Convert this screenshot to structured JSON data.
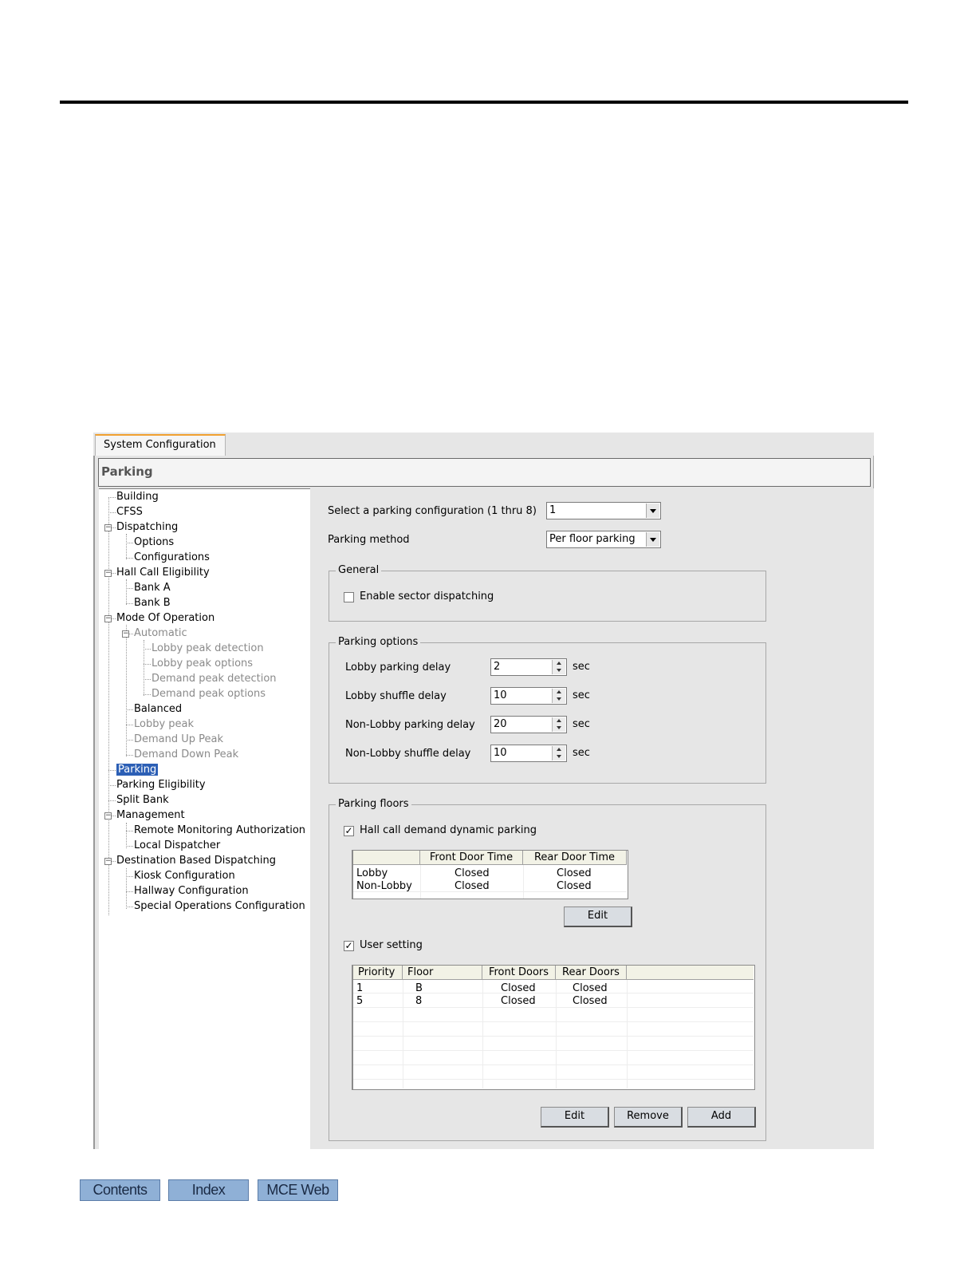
{
  "window": {
    "tab_label": "System Configuration",
    "section_title": "Parking"
  },
  "tree": {
    "items": [
      {
        "label": "Building",
        "level": 0,
        "state": "normal"
      },
      {
        "label": "CFSS",
        "level": 0,
        "state": "normal"
      },
      {
        "label": "Dispatching",
        "level": 0,
        "state": "expanded"
      },
      {
        "label": "Options",
        "level": 1,
        "state": "normal"
      },
      {
        "label": "Configurations",
        "level": 1,
        "state": "normal"
      },
      {
        "label": "Hall Call Eligibility",
        "level": 0,
        "state": "expanded"
      },
      {
        "label": "Bank A",
        "level": 1,
        "state": "normal"
      },
      {
        "label": "Bank B",
        "level": 1,
        "state": "normal"
      },
      {
        "label": "Mode Of Operation",
        "level": 0,
        "state": "expanded"
      },
      {
        "label": "Automatic",
        "level": 1,
        "state": "expanded-disabled"
      },
      {
        "label": "Lobby peak detection",
        "level": 2,
        "state": "disabled"
      },
      {
        "label": "Lobby peak options",
        "level": 2,
        "state": "disabled"
      },
      {
        "label": "Demand peak detection",
        "level": 2,
        "state": "disabled"
      },
      {
        "label": "Demand peak options",
        "level": 2,
        "state": "disabled"
      },
      {
        "label": "Balanced",
        "level": 1,
        "state": "normal"
      },
      {
        "label": "Lobby peak",
        "level": 1,
        "state": "disabled"
      },
      {
        "label": "Demand Up Peak",
        "level": 1,
        "state": "disabled"
      },
      {
        "label": "Demand Down Peak",
        "level": 1,
        "state": "disabled"
      },
      {
        "label": "Parking",
        "level": 0,
        "state": "selected"
      },
      {
        "label": "Parking Eligibility",
        "level": 0,
        "state": "normal"
      },
      {
        "label": "Split Bank",
        "level": 0,
        "state": "normal"
      },
      {
        "label": "Management",
        "level": 0,
        "state": "expanded"
      },
      {
        "label": "Remote Monitoring Authorization",
        "level": 1,
        "state": "normal"
      },
      {
        "label": "Local Dispatcher",
        "level": 1,
        "state": "normal"
      },
      {
        "label": "Destination Based Dispatching",
        "level": 0,
        "state": "expanded"
      },
      {
        "label": "Kiosk Configuration",
        "level": 1,
        "state": "normal"
      },
      {
        "label": "Hallway Configuration",
        "level": 1,
        "state": "normal"
      },
      {
        "label": "Special Operations Configuration",
        "level": 1,
        "state": "normal"
      }
    ]
  },
  "form": {
    "config_label": "Select a parking configuration (1 thru 8)",
    "config_value": "1",
    "method_label": "Parking method",
    "method_value": "Per floor parking",
    "general": {
      "legend": "General",
      "enable_sector_label": "Enable sector dispatching",
      "enable_sector_checked": false
    },
    "options": {
      "legend": "Parking options",
      "unit": "sec",
      "rows": [
        {
          "label": "Lobby parking delay",
          "value": "2"
        },
        {
          "label": "Lobby shuffle delay",
          "value": "10"
        },
        {
          "label": "Non-Lobby parking delay",
          "value": "20"
        },
        {
          "label": "Non-Lobby shuffle delay",
          "value": "10"
        }
      ]
    },
    "floors": {
      "legend": "Parking floors",
      "hall_call_label": "Hall call demand dynamic parking",
      "hall_call_checked": true,
      "door_table": {
        "headers": [
          "",
          "Front Door Time",
          "Rear Door Time"
        ],
        "rows": [
          [
            "Lobby",
            "Closed",
            "Closed"
          ],
          [
            "Non-Lobby",
            "Closed",
            "Closed"
          ]
        ]
      },
      "edit_label": "Edit",
      "user_setting_label": "User setting",
      "user_setting_checked": true,
      "user_table": {
        "headers": [
          "Priority",
          "Floor",
          "Front Doors",
          "Rear Doors"
        ],
        "rows": [
          [
            "1",
            "B",
            "Closed",
            "Closed"
          ],
          [
            "5",
            "8",
            "Closed",
            "Closed"
          ]
        ]
      },
      "buttons": {
        "edit": "Edit",
        "remove": "Remove",
        "add": "Add"
      }
    }
  },
  "footer_nav": {
    "contents": "Contents",
    "index": "Index",
    "mce_web": "MCE Web"
  },
  "colors": {
    "selection": "#2c5fb5",
    "tab_accent": "#f0a030",
    "nav_button": "#8fb0d6"
  }
}
